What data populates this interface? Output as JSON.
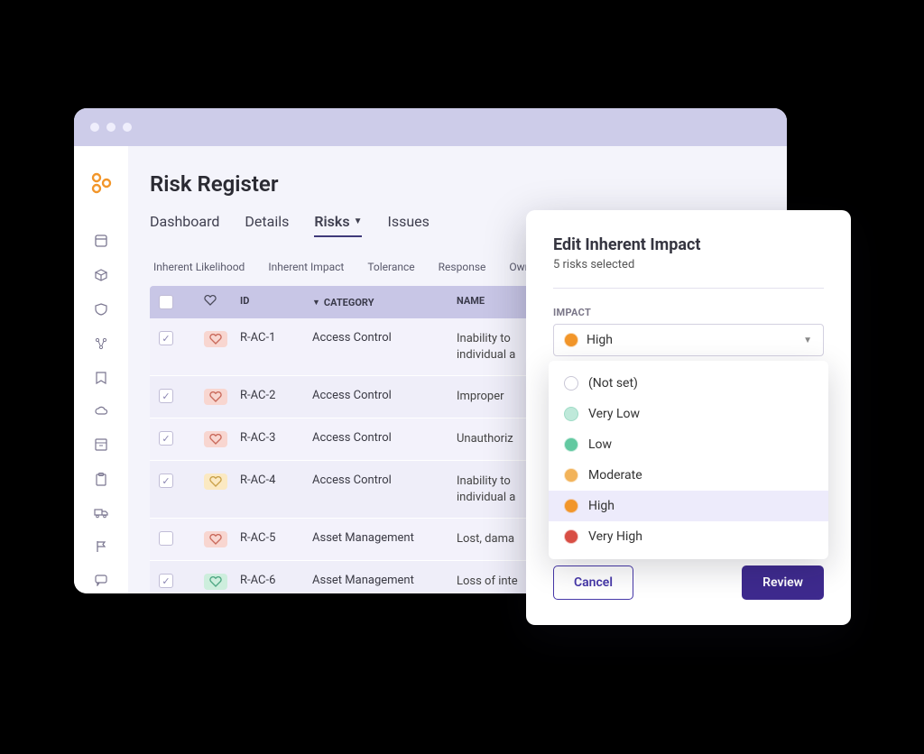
{
  "page_title": "Risk Register",
  "tabs": [
    "Dashboard",
    "Details",
    "Risks",
    "Issues"
  ],
  "active_tab": "Risks",
  "filters": [
    "Inherent Likelihood",
    "Inherent Impact",
    "Tolerance",
    "Response",
    "Owner"
  ],
  "columns": {
    "id": "ID",
    "category": "CATEGORY",
    "name": "NAME"
  },
  "rows": [
    {
      "checked": true,
      "heart": "red",
      "id": "R-AC-1",
      "category": "Access Control",
      "name": "Inability to individual a"
    },
    {
      "checked": true,
      "heart": "red",
      "id": "R-AC-2",
      "category": "Access Control",
      "name": "Improper"
    },
    {
      "checked": true,
      "heart": "red",
      "id": "R-AC-3",
      "category": "Access Control",
      "name": "Unauthoriz"
    },
    {
      "checked": true,
      "heart": "yellow",
      "id": "R-AC-4",
      "category": "Access Control",
      "name": "Inability to individual a"
    },
    {
      "checked": false,
      "heart": "red",
      "id": "R-AC-5",
      "category": "Asset Management",
      "name": "Lost, dama"
    },
    {
      "checked": true,
      "heart": "green",
      "id": "R-AC-6",
      "category": "Asset Management",
      "name": "Loss of inte"
    }
  ],
  "modal": {
    "title": "Edit Inherent Impact",
    "subtitle": "5 risks selected",
    "field_label": "IMPACT",
    "selected": "High",
    "options": [
      {
        "key": "notset",
        "label": "(Not set)"
      },
      {
        "key": "vlow",
        "label": "Very Low"
      },
      {
        "key": "low",
        "label": "Low"
      },
      {
        "key": "mod",
        "label": "Moderate"
      },
      {
        "key": "high",
        "label": "High"
      },
      {
        "key": "vhigh",
        "label": "Very High"
      }
    ],
    "cancel": "Cancel",
    "review": "Review"
  }
}
